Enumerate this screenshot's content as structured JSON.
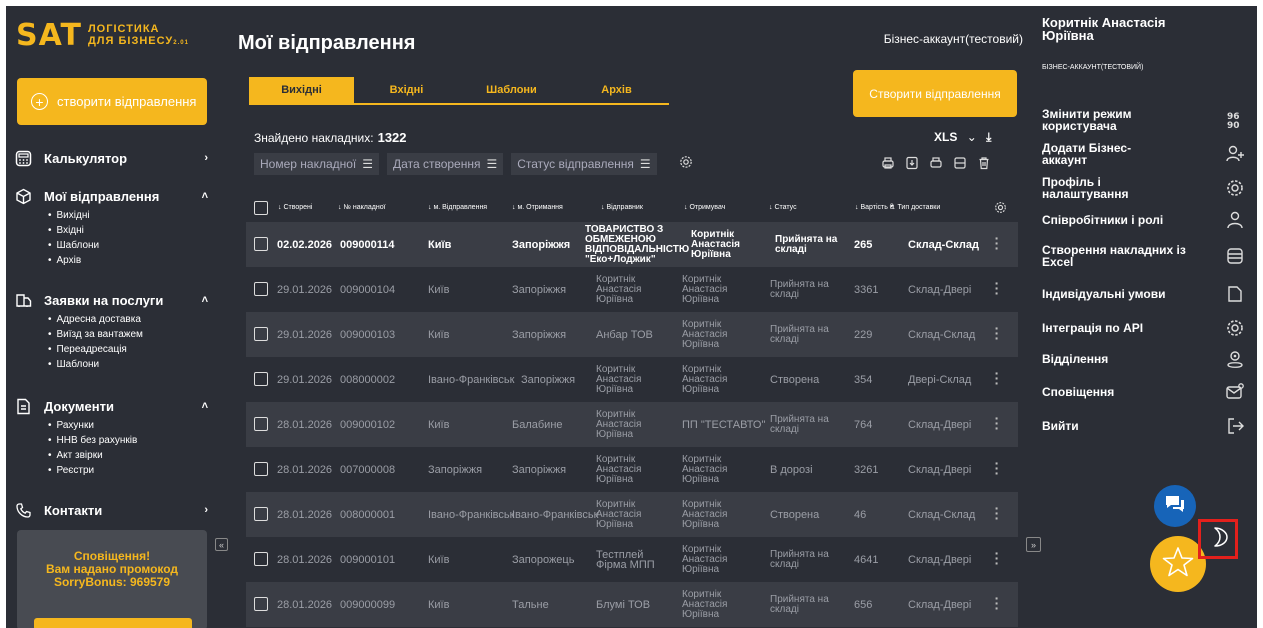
{
  "logo": {
    "brand": "SAT",
    "line1": "ЛОГІСТИКА",
    "line2": "ДЛЯ БІЗНЕСУ",
    "version": "2.01"
  },
  "sidebar": {
    "create_button": "створити відправлення",
    "sections": [
      {
        "label": "Калькулятор",
        "icon": "calculator-icon",
        "items": []
      },
      {
        "label": "Мої відправлення",
        "icon": "package-icon",
        "items": [
          "Вихідні",
          "Вхідні",
          "Шаблони",
          "Архів"
        ]
      },
      {
        "label": "Заявки на послуги",
        "icon": "service-request-icon",
        "items": [
          "Адресна доставка",
          "Виїзд за вантажем",
          "Переадресація",
          "Шаблони"
        ]
      },
      {
        "label": "Документи",
        "icon": "document-icon",
        "items": [
          "Рахунки",
          "НHB без рахунків",
          "Акт звірки",
          "Реєстри"
        ]
      },
      {
        "label": "Контакти",
        "icon": "contacts-phone-icon",
        "items": []
      }
    ],
    "notification": {
      "line1": "Сповіщення!",
      "line2": "Вам надано промокод",
      "line3": "SorryBonus: 969579"
    }
  },
  "header": {
    "title": "Мої відправлення",
    "account": "Бізнес-аккаунт(тестовий)"
  },
  "tabs": [
    "Вихідні",
    "Вхідні",
    "Шаблони",
    "Архів"
  ],
  "create_shipment_button": "Створити відправлення",
  "found": {
    "label": "Знайдено накладних:",
    "count": "1322"
  },
  "xls": "XLS",
  "filters": [
    "Номер накладної",
    "Дата створення",
    "Статус відправлення"
  ],
  "table": {
    "columns": [
      "Створені",
      "№ накладної",
      "м. Відправлення",
      "м. Отримання",
      "Відправник",
      "Отримувач",
      "Статус",
      "Вартість ₴",
      "Тип доставки"
    ],
    "rows": [
      {
        "date": "02.02.2026",
        "number": "009000114",
        "from": "Київ",
        "to": "Запоріжжя",
        "sender": "ТОВАРИСТВО З ОБМЕЖЕНОЮ ВІДПОВІДАЛЬНІСТЮ \"Еко+Лоджик\"",
        "receiver": "Коритнік Анастасія Юріївна",
        "status": "Прийнята на складі",
        "cost": "265",
        "type": "Склад-Склад"
      },
      {
        "date": "29.01.2026",
        "number": "009000104",
        "from": "Київ",
        "to": "Запоріжжя",
        "sender": "Коритнік Анастасія Юріївна",
        "receiver": "Коритнік Анастасія Юріївна",
        "status": "Прийнята на складі",
        "cost": "3361",
        "type": "Склад-Двері"
      },
      {
        "date": "29.01.2026",
        "number": "009000103",
        "from": "Київ",
        "to": "Запоріжжя",
        "sender": "Анбар ТОВ",
        "receiver": "Коритнік Анастасія Юріївна",
        "status": "Прийнята на складі",
        "cost": "229",
        "type": "Склад-Склад"
      },
      {
        "date": "29.01.2026",
        "number": "008000002",
        "from": "Івано-Франківськ",
        "to": "Запоріжжя",
        "sender": "Коритнік Анастасія Юріївна",
        "receiver": "Коритнік Анастасія Юріївна",
        "status": "Створена",
        "cost": "354",
        "type": "Двері-Склад"
      },
      {
        "date": "28.01.2026",
        "number": "009000102",
        "from": "Київ",
        "to": "Балабине",
        "sender": "Коритнік Анастасія Юріївна",
        "receiver": "ПП \"ТЕСТАВТО\"",
        "status": "Прийнята на складі",
        "cost": "764",
        "type": "Склад-Двері"
      },
      {
        "date": "28.01.2026",
        "number": "007000008",
        "from": "Запоріжжя",
        "to": "Запоріжжя",
        "sender": "Коритнік Анастасія Юріївна",
        "receiver": "Коритнік Анастасія Юріївна",
        "status": "В дорозі",
        "cost": "3261",
        "type": "Склад-Двері"
      },
      {
        "date": "28.01.2026",
        "number": "008000001",
        "from": "Івано-Франківськ",
        "to": "Івано-Франківськ",
        "sender": "Коритнік Анастасія Юріївна",
        "receiver": "Коритнік Анастасія Юріївна",
        "status": "Створена",
        "cost": "46",
        "type": "Склад-Склад"
      },
      {
        "date": "28.01.2026",
        "number": "009000101",
        "from": "Київ",
        "to": "Запорожець",
        "sender": "Тестплей Фірма МПП",
        "receiver": "Коритнік Анастасія Юріївна",
        "status": "Прийнята на складі",
        "cost": "4641",
        "type": "Склад-Двері"
      },
      {
        "date": "28.01.2026",
        "number": "009000099",
        "from": "Київ",
        "to": "Тальне",
        "sender": "Блумі ТОВ",
        "receiver": "Коритнік Анастасія Юріївна",
        "status": "Прийнята на складі",
        "cost": "656",
        "type": "Склад-Двері"
      }
    ]
  },
  "user": {
    "name": "Коритнік Анастасія Юріївна",
    "type": "БІЗНЕС-АККАУНТ(ТЕСТОВИЙ)"
  },
  "right_menu": [
    {
      "label": "Змінити режим користувача",
      "icon": "switch-mode-icon"
    },
    {
      "label": "Додати Бізнес-аккаунт",
      "icon": "add-user-icon"
    },
    {
      "label": "Профіль і налаштування",
      "icon": "settings-icon"
    },
    {
      "label": "Співробітники і ролі",
      "icon": "user-icon"
    },
    {
      "label": "Створення накладних із Excel",
      "icon": "table-icon"
    },
    {
      "label": "Індивідуальні умови",
      "icon": "document-icon"
    },
    {
      "label": "Інтеграція по API",
      "icon": "api-gear-icon"
    },
    {
      "label": "Відділення",
      "icon": "location-icon"
    },
    {
      "label": "Сповіщення",
      "icon": "mail-icon"
    },
    {
      "label": "Вийти",
      "icon": "logout-icon"
    }
  ],
  "colors": {
    "accent": "#f5b71e",
    "bg": "#2b2e36",
    "row_alt": "#3a3d45",
    "chat": "#1764b8",
    "highlight": "#e3201c"
  }
}
